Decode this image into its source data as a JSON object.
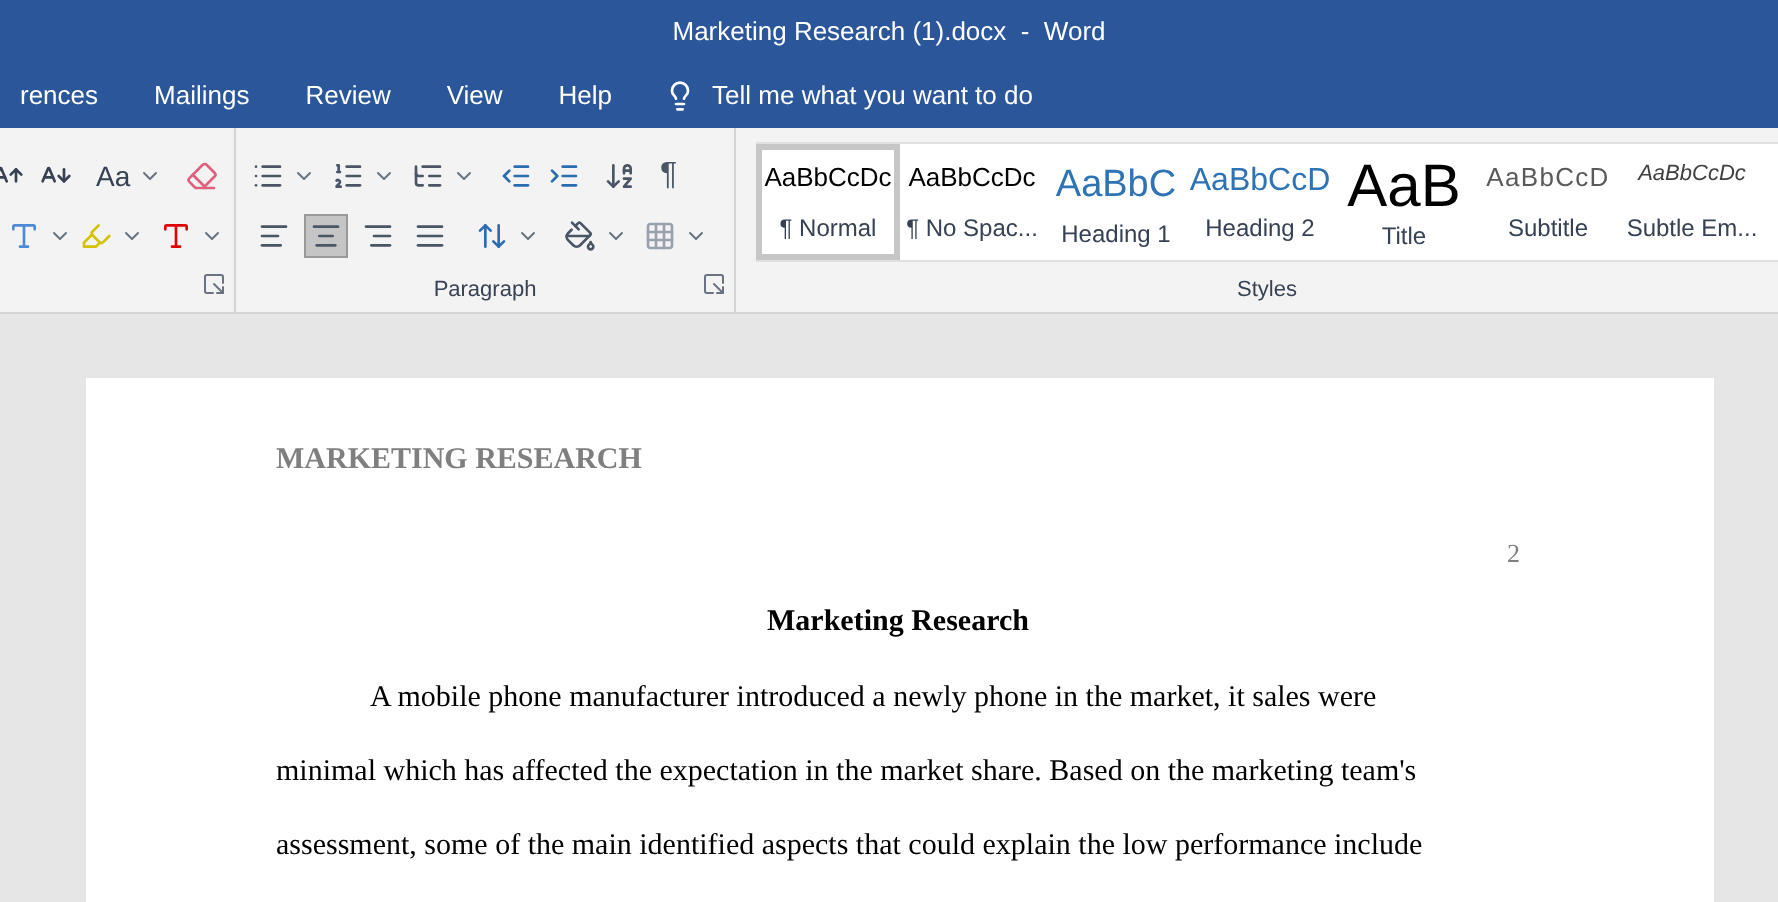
{
  "window": {
    "title": "Marketing Research (1).docx  -  Word"
  },
  "tabs": [
    {
      "label": "rences",
      "selected": false
    },
    {
      "label": "Mailings",
      "selected": false
    },
    {
      "label": "Review",
      "selected": false
    },
    {
      "label": "View",
      "selected": false
    },
    {
      "label": "Help",
      "selected": false
    }
  ],
  "tell_me": {
    "placeholder": "Tell me what you want to do"
  },
  "font_group": {
    "change_case": "Aa"
  },
  "paragraph_group": {
    "label": "Paragraph",
    "show_marks": "¶",
    "alignment": [
      {
        "kind": "left",
        "selected": false
      },
      {
        "kind": "center",
        "selected": true
      },
      {
        "kind": "right",
        "selected": false
      },
      {
        "kind": "justify",
        "selected": false
      }
    ]
  },
  "styles": {
    "label": "Styles",
    "items": [
      {
        "preview": "AaBbCcDc",
        "name": "¶ Normal",
        "kind": "normal",
        "selected": true
      },
      {
        "preview": "AaBbCcDc",
        "name": "¶ No Spac...",
        "kind": "normal",
        "selected": false
      },
      {
        "preview": "AaBbC",
        "name": "Heading 1",
        "kind": "heading1",
        "selected": false
      },
      {
        "preview": "AaBbCcD",
        "name": "Heading 2",
        "kind": "heading2",
        "selected": false
      },
      {
        "preview": "AaB",
        "name": "Title",
        "kind": "title",
        "selected": false
      },
      {
        "preview": "AaBbCcD",
        "name": "Subtitle",
        "kind": "subtitle",
        "selected": false
      },
      {
        "preview": "AaBbCcDc",
        "name": "Subtle Em...",
        "kind": "emphasis",
        "selected": false
      }
    ]
  },
  "document": {
    "header": "MARKETING RESEARCH",
    "page_number": "2",
    "title": "Marketing Research",
    "lines": [
      "A mobile phone manufacturer introduced a newly phone in the market, it sales were",
      "minimal which has affected the expectation in the market share. Based on the marketing team's",
      "assessment, some of the main identified aspects that could explain the low performance include"
    ]
  }
}
